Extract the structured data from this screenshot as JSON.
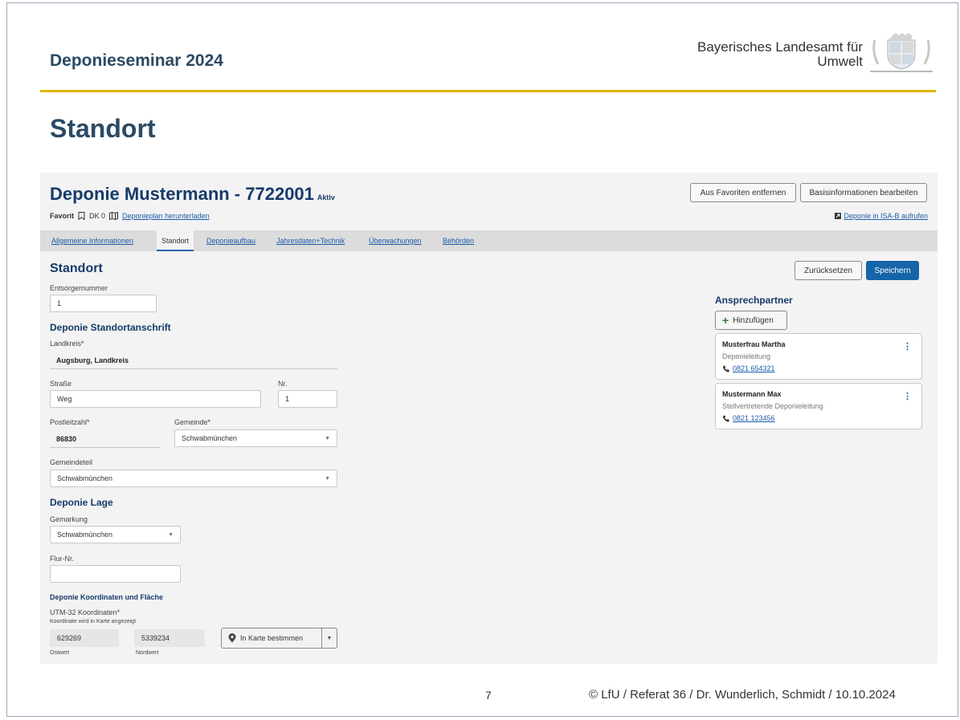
{
  "header": {
    "seminar": "Deponieseminar 2024",
    "org_line1": "Bayerisches Landesamt für",
    "org_line2": "Umwelt",
    "slide_title": "Standort"
  },
  "app": {
    "title": "Deponie Mustermann - 7722001",
    "status": "Aktiv",
    "btn_remove_fav": "Aus Favoriten entfernen",
    "btn_edit_basic": "Basisinformationen bearbeiten",
    "favorit_label": "Favorit",
    "dk": "DK 0",
    "download_link": "Deponieplan herunterladen",
    "isa_link": "Deponie in ISA-B aufrufen",
    "tabs": [
      {
        "label": "Allgemeine Informationen"
      },
      {
        "label": "Standort"
      },
      {
        "label": "Deponieaufbau"
      },
      {
        "label": "Jahresdaten+Technik"
      },
      {
        "label": "Überwachungen"
      },
      {
        "label": "Behörden"
      }
    ],
    "active_tab": "Standort",
    "btn_reset": "Zurücksetzen",
    "btn_save": "Speichern"
  },
  "form": {
    "section_title": "Standort",
    "entsorger_label": "Entsorgernummer",
    "entsorger_value": "1",
    "anschrift_title": "Deponie Standortanschrift",
    "landkreis_label": "Landkreis*",
    "landkreis_value": "Augsburg, Landkreis",
    "strasse_label": "Straße",
    "strasse_value": "Weg",
    "nr_label": "Nr.",
    "nr_value": "1",
    "plz_label": "Postleitzahl*",
    "plz_value": "86830",
    "gemeinde_label": "Gemeinde*",
    "gemeinde_value": "Schwabmünchen",
    "gemeindeteil_label": "Gemeindeteil",
    "gemeindeteil_value": "Schwabmünchen",
    "lage_title": "Deponie Lage",
    "gemarkung_label": "Gemarkung",
    "gemarkung_value": "Schwabmünchen",
    "flur_label": "Flur-Nr.",
    "flur_value": "",
    "koord_title": "Deponie Koordinaten und Fläche",
    "utm_label": "UTM-32 Koordinaten*",
    "utm_hint": "Koordinate wird in Karte angezeigt",
    "ostwert_value": "629269",
    "nordwert_value": "5339234",
    "ostwert_label": "Ostwert",
    "nordwert_label": "Nordwert",
    "map_button": "In Karte bestimmen"
  },
  "contacts": {
    "title": "Ansprechpartner",
    "add_label": "Hinzufügen",
    "items": [
      {
        "name": "Musterfrau Martha",
        "role": "Deponieleitung",
        "phone": "0821 654321"
      },
      {
        "name": "Mustermann Max",
        "role": "Stellvertretende Deponieleitung",
        "phone": "0821 123456"
      }
    ]
  },
  "footer": {
    "page": "7",
    "copyright": "© LfU / Referat 36 / Dr. Wunderlich, Schmidt / 10.10.2024"
  },
  "colors": {
    "accent_gold": "#e2b400",
    "title_blue": "#2b4a63",
    "primary_blue": "#1565a8"
  }
}
